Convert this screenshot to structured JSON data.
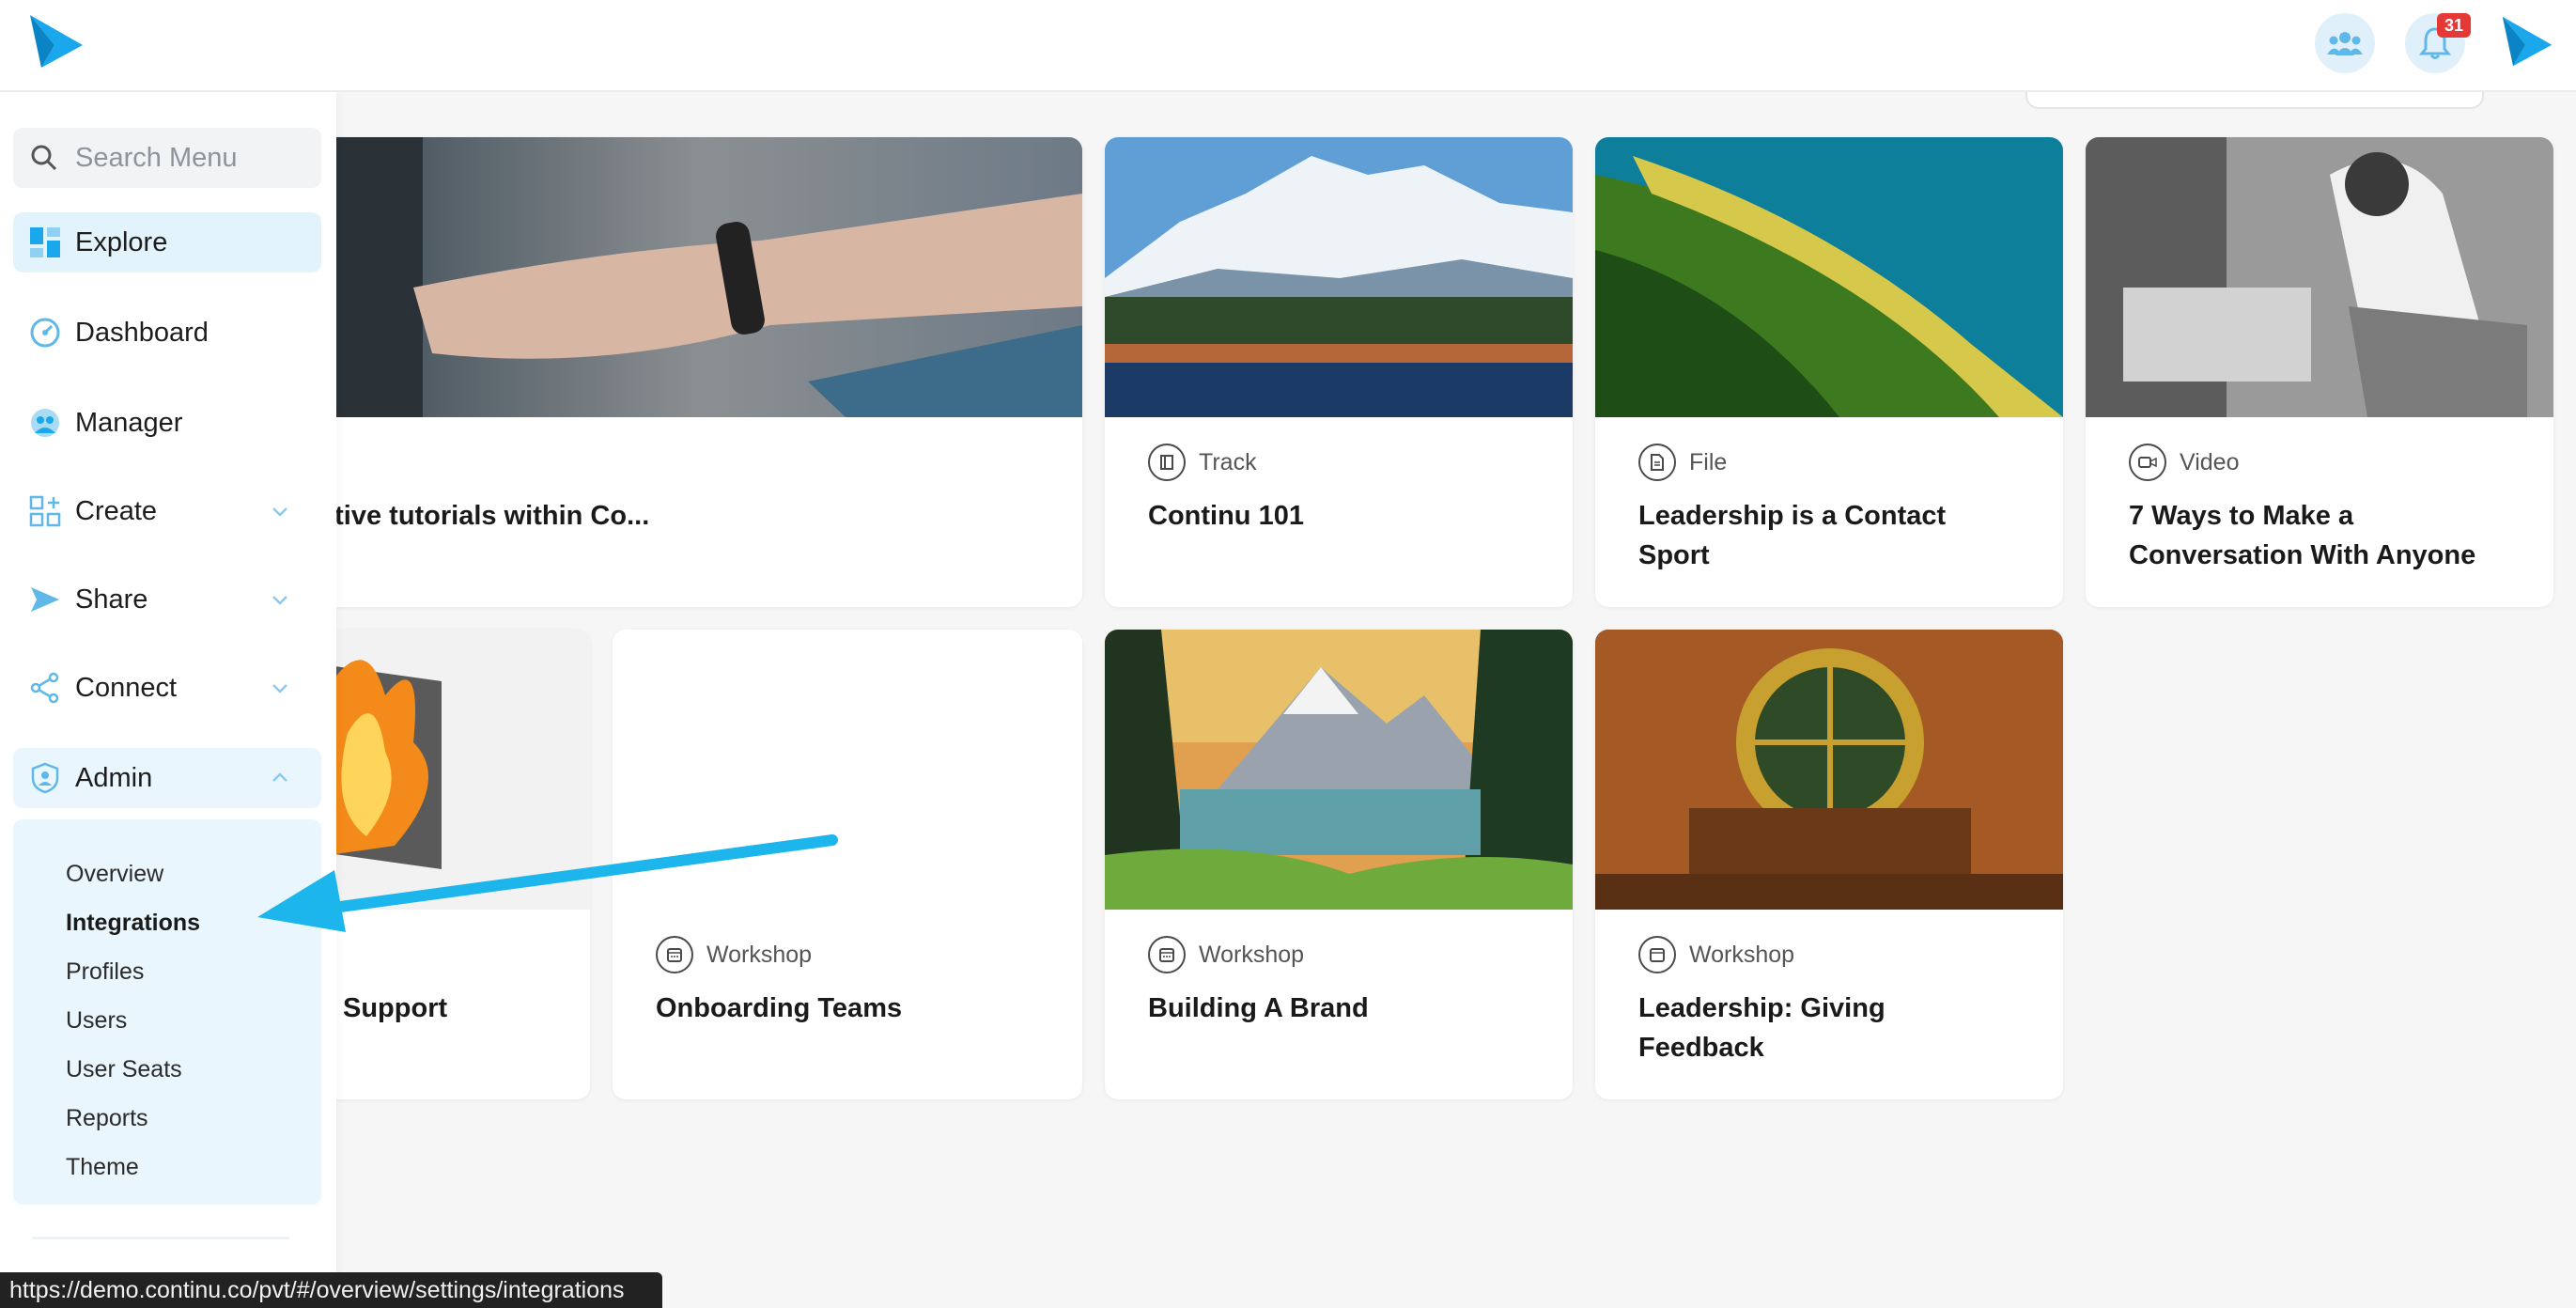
{
  "sidebar": {
    "search_placeholder": "Search Menu",
    "items": [
      {
        "label": "Explore",
        "icon": "grid-icon"
      },
      {
        "label": "Dashboard",
        "icon": "dashboard-icon"
      },
      {
        "label": "Manager",
        "icon": "manager-icon"
      },
      {
        "label": "Create",
        "icon": "create-icon"
      },
      {
        "label": "Share",
        "icon": "send-icon"
      },
      {
        "label": "Connect",
        "icon": "share-nodes-icon"
      },
      {
        "label": "Admin",
        "icon": "shield-icon"
      }
    ],
    "admin_submenu": [
      "Overview",
      "Integrations",
      "Profiles",
      "Users",
      "User Seats",
      "Reports",
      "Theme"
    ]
  },
  "header": {
    "notification_count": "31"
  },
  "cards": [
    {
      "type": "",
      "title": "ctive tutorials within Co..."
    },
    {
      "type": "Track",
      "title": "Continu 101"
    },
    {
      "type": "File",
      "title": "Leadership is a Contact Sport"
    },
    {
      "type": "Video",
      "title": "7 Ways to Make a Conversation With Anyone"
    },
    {
      "type": "",
      "title": "Support"
    },
    {
      "type": "Workshop",
      "title": "Onboarding Teams"
    },
    {
      "type": "Workshop",
      "title": "Building A Brand"
    },
    {
      "type": "Workshop",
      "title": "Leadership: Giving Feedback"
    }
  ],
  "status_bar": {
    "url": "https://demo.continu.co/pvt/#/overview/settings/integrations"
  },
  "colors": {
    "accent": "#1aa7ec",
    "active_bg": "#e3f3fc",
    "badge": "#e53935"
  }
}
